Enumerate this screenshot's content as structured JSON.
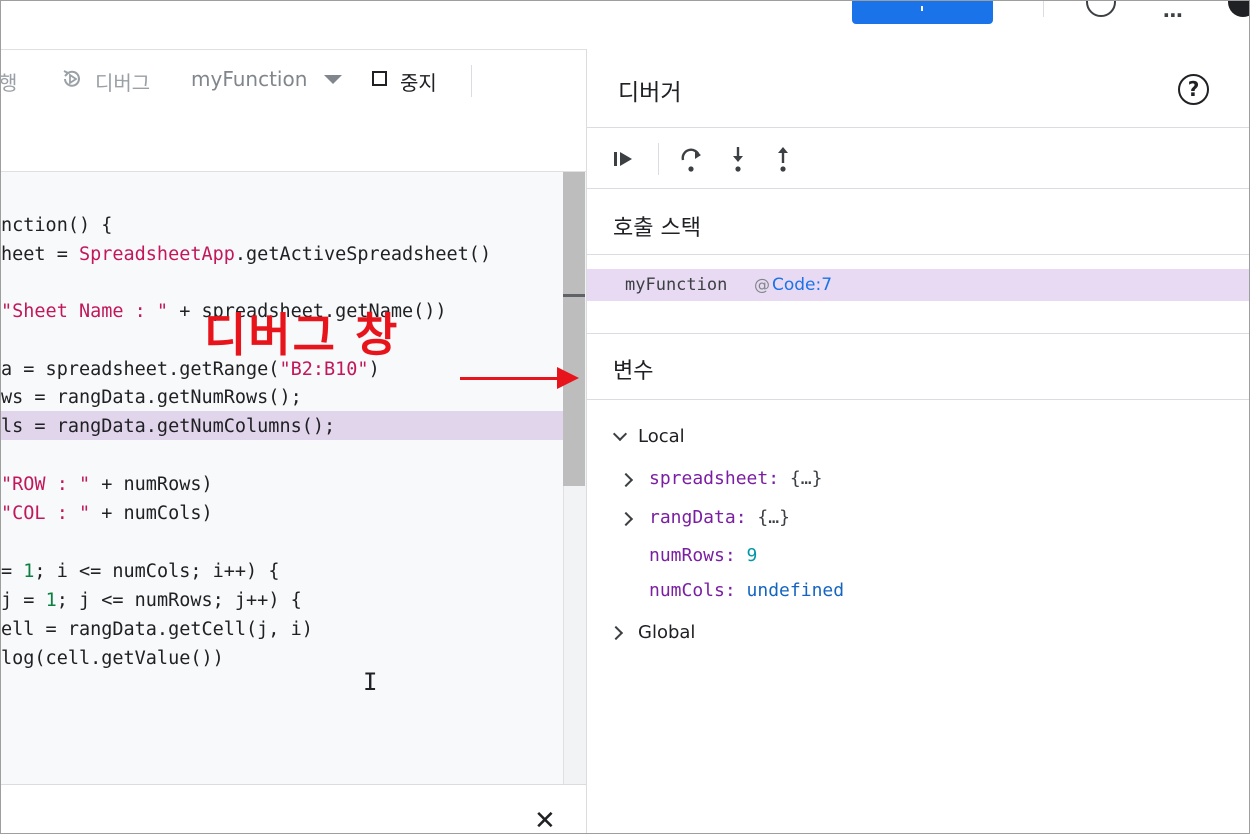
{
  "toolbar": {
    "run_label": "행",
    "debug_label": "디버그",
    "function_select": "myFunction",
    "stop_label": "중지"
  },
  "code_lines": [
    {
      "pre": "nction() {",
      "str": "",
      "post": ""
    },
    {
      "pre": "heet = ",
      "cls": "SpreadsheetApp",
      "post": ".getActiveSpreadsheet()"
    },
    {
      "pre": "",
      "str": "\"Sheet Name : \"",
      "post": " + spreadsheet.getName())"
    },
    {
      "pre": "a = spreadsheet.getRange(",
      "str": "\"B2:B10\"",
      "post": ")"
    },
    {
      "pre": "ws = rangData.getNumRows();",
      "str": "",
      "post": ""
    },
    {
      "pre": "ls = rangData.getNumColumns();",
      "str": "",
      "post": ""
    },
    {
      "pre": "",
      "str": "\"ROW : \"",
      "post": " + numRows)"
    },
    {
      "pre": "",
      "str": "\"COL : \"",
      "post": " + numCols)"
    },
    {
      "pre": "= ",
      "num": "1",
      "post": "; i <= numCols; i++) {"
    },
    {
      "pre": "j = ",
      "num": "1",
      "post": "; j <= numRows; j++) {"
    },
    {
      "pre": "ell = rangData.getCell(j, i)",
      "str": "",
      "post": ""
    },
    {
      "pre": "log(cell.getValue())",
      "str": "",
      "post": ""
    }
  ],
  "annotation": {
    "label": "디버그 창",
    "color": "#e8141c"
  },
  "debugger": {
    "title": "디버거",
    "call_stack_title": "호출 스택",
    "call_stack": [
      {
        "function": "myFunction",
        "at": "@",
        "location": "Code:7"
      }
    ],
    "variables_title": "변수",
    "local_label": "Local",
    "global_label": "Global",
    "variables": [
      {
        "name": "spreadsheet:",
        "value": "{…}"
      },
      {
        "name": "rangData:",
        "value": "{…}"
      },
      {
        "name": "numRows:",
        "value": "9"
      },
      {
        "name": "numCols:",
        "value": "undefined"
      }
    ]
  },
  "colors": {
    "accent_blue": "#1a73e8",
    "highlight_purple": "#e1d5ec"
  },
  "icons": [
    "resume-icon",
    "step-over-icon",
    "step-into-icon",
    "step-out-icon",
    "help-icon",
    "close-icon",
    "debug-icon",
    "stop-icon",
    "more-icon"
  ]
}
